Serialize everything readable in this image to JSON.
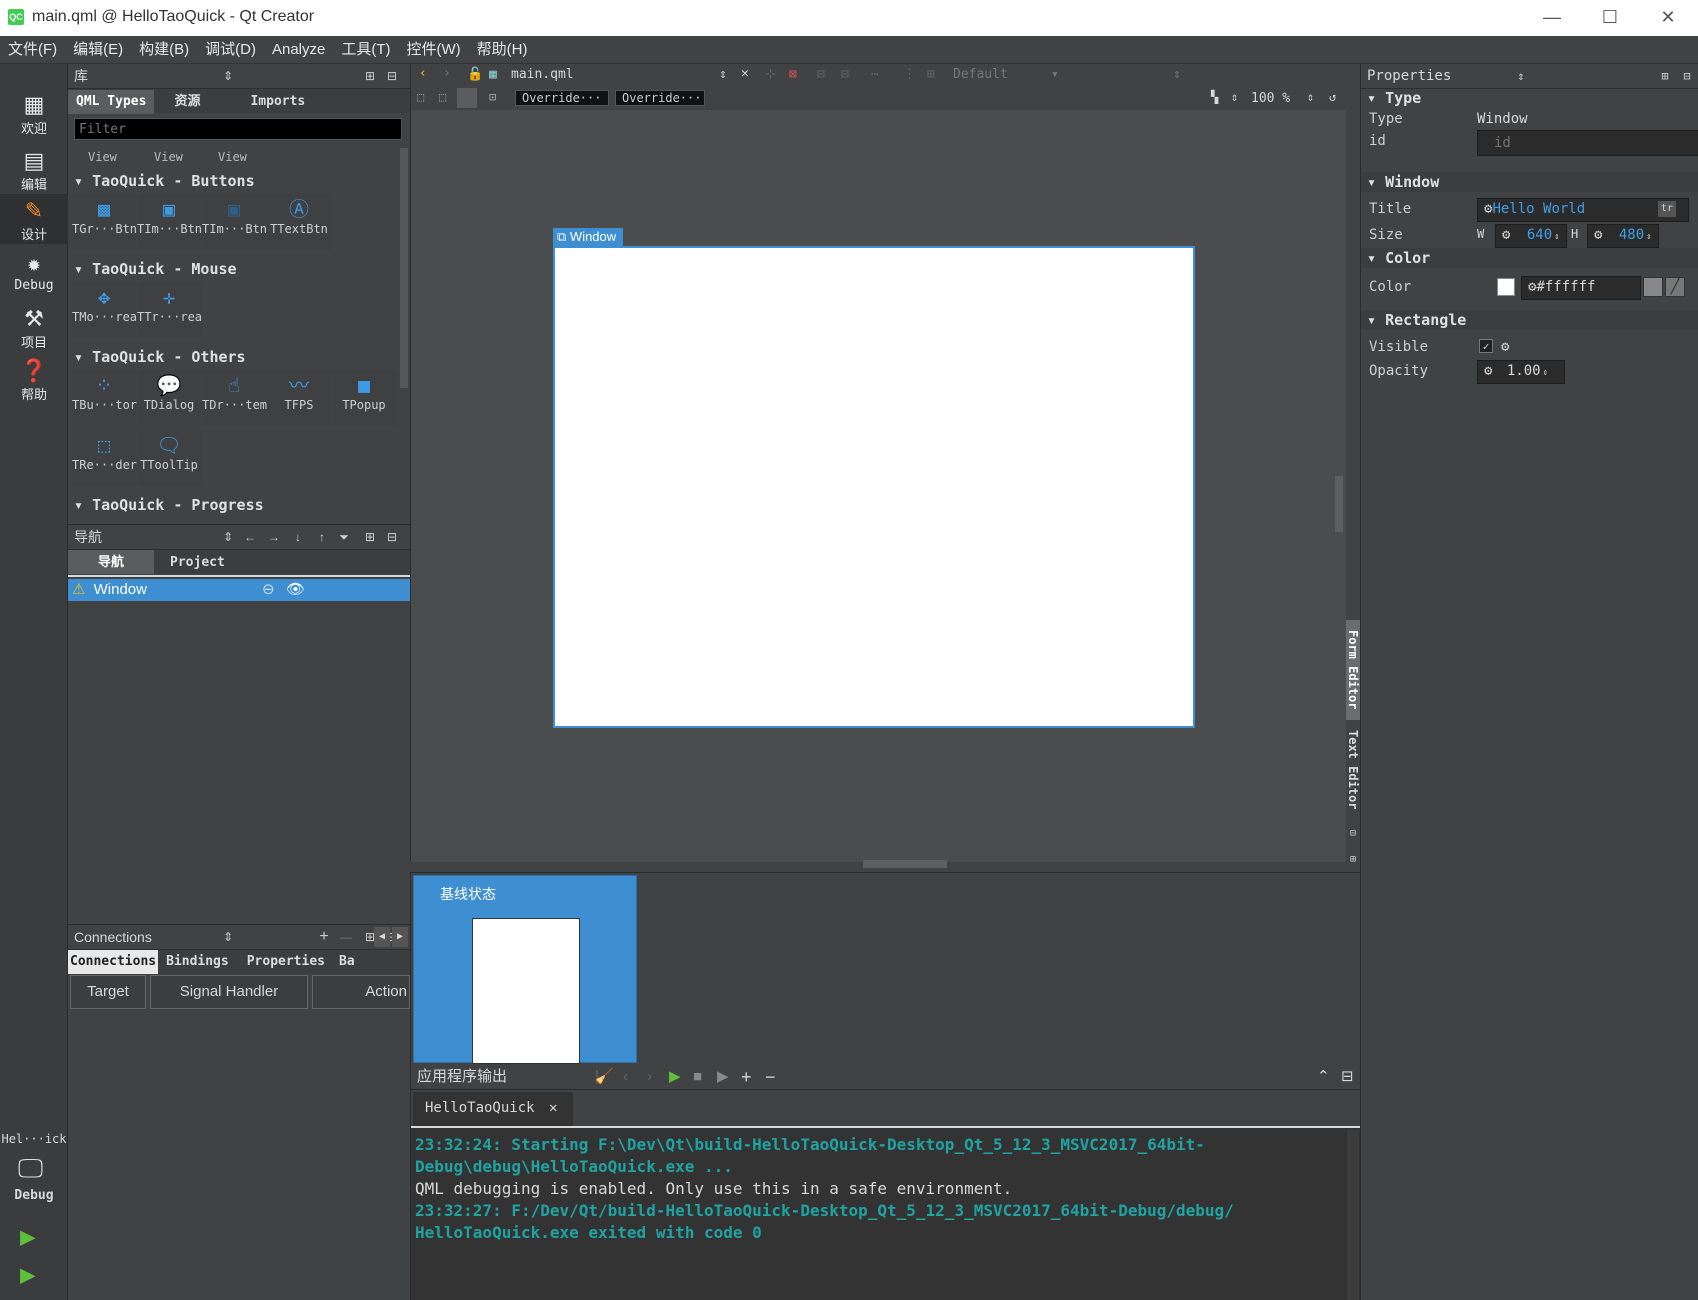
{
  "window": {
    "title": "main.qml @ HelloTaoQuick - Qt Creator",
    "logo": "QC"
  },
  "menu": [
    "文件(F)",
    "编辑(E)",
    "构建(B)",
    "调试(D)",
    "Analyze",
    "工具(T)",
    "控件(W)",
    "帮助(H)"
  ],
  "modes": [
    "欢迎",
    "编辑",
    "设计",
    "Debug",
    "项目",
    "帮助"
  ],
  "kit": {
    "name": "Hel···ick",
    "mode": "Debug"
  },
  "library": {
    "header": "库",
    "tabs": [
      "QML Types",
      "资源",
      "Imports"
    ],
    "filter_placeholder": "Filter",
    "partial_items": [
      "View",
      "View",
      "View"
    ],
    "sections": [
      {
        "title": "TaoQuick - Buttons",
        "items": [
          "TGr···Btn",
          "TIm···Btn",
          "TIm···Btn",
          "TTextBtn"
        ]
      },
      {
        "title": "TaoQuick - Mouse",
        "items": [
          "TMo···rea",
          "TTr···rea"
        ]
      },
      {
        "title": "TaoQuick - Others",
        "items": [
          "TBu···tor",
          "TDialog",
          "TDr···tem",
          "TFPS",
          "TPopup",
          "TRe···der",
          "TToolTip"
        ]
      },
      {
        "title": "TaoQuick - Progress",
        "items": []
      }
    ]
  },
  "navigator": {
    "header": "导航",
    "tabs": [
      "导航",
      "Project"
    ],
    "root": "Window"
  },
  "connections": {
    "header": "Connections",
    "tabs": [
      "Connections",
      "Bindings",
      "Properties",
      "Ba"
    ],
    "columns": [
      "Target",
      "Signal Handler",
      "Action"
    ]
  },
  "editor": {
    "file": "main.qml",
    "style": "Default",
    "override1": "Override···",
    "override2": "Override···",
    "zoom": "100 %",
    "window_label": "Window",
    "side_tabs": [
      "Form Editor",
      "Text Editor"
    ]
  },
  "states": {
    "base_state": "基线状态"
  },
  "output": {
    "header": "应用程序输出",
    "tab": "HelloTaoQuick",
    "lines": [
      {
        "text": "23:32:24: Starting F:\\Dev\\Qt\\build-HelloTaoQuick-Desktop_Qt_5_12_3_MSVC2017_64bit-",
        "style": "teal"
      },
      {
        "text": "Debug\\debug\\HelloTaoQuick.exe ...",
        "style": "teal"
      },
      {
        "text": "QML debugging is enabled. Only use this in a safe environment.",
        "style": "plain"
      },
      {
        "text": "23:32:27: F:/Dev/Qt/build-HelloTaoQuick-Desktop_Qt_5_12_3_MSVC2017_64bit-Debug/debug/",
        "style": "teal"
      },
      {
        "text": "HelloTaoQuick.exe exited with code 0",
        "style": "teal"
      }
    ]
  },
  "properties": {
    "header": "Properties",
    "type_section": "Type",
    "type_label": "Type",
    "type_value": "Window",
    "id_label": "id",
    "id_placeholder": "id",
    "window_section": "Window",
    "title_label": "Title",
    "title_value": "Hello World",
    "tr": "tr",
    "size_label": "Size",
    "w_label": "W",
    "w_value": "640",
    "h_label": "H",
    "h_value": "480",
    "color_section": "Color",
    "color_label": "Color",
    "color_value": "#ffffff",
    "rect_section": "Rectangle",
    "visible_label": "Visible",
    "visible_checked": "✓",
    "opacity_label": "Opacity",
    "opacity_value": "1.00"
  },
  "colors": {
    "accent": "#3d8fd1",
    "teal": "#1fa3a3",
    "warning": "#f0c020"
  }
}
